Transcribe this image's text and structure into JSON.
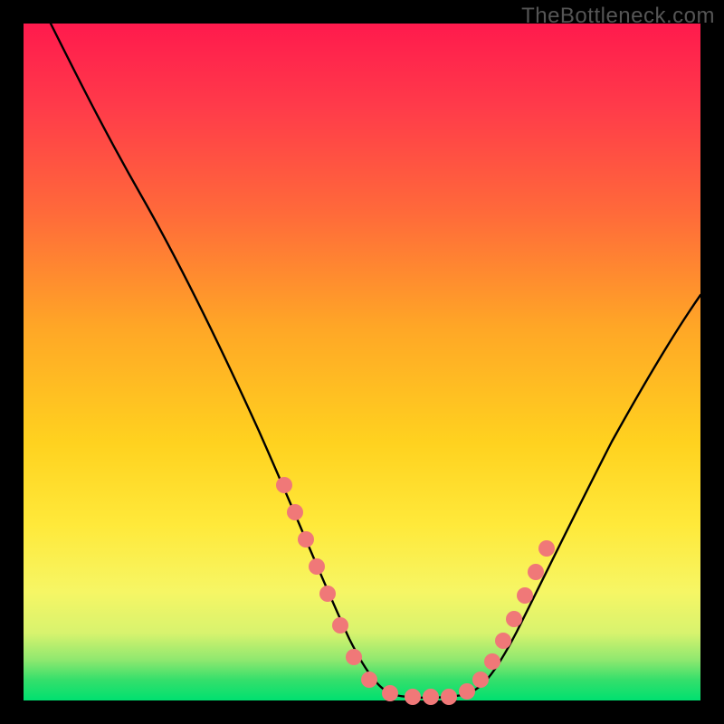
{
  "watermark": "TheBottleneck.com",
  "colors": {
    "frame": "#000000",
    "curve": "#000000",
    "dot": "#f07878",
    "gradient_top": "#ff1a4d",
    "gradient_mid": "#ffd21f",
    "gradient_bottom": "#00e070"
  },
  "chart_data": {
    "type": "line",
    "title": "",
    "xlabel": "",
    "ylabel": "",
    "xlim": [
      0,
      100
    ],
    "ylim": [
      0,
      100
    ],
    "grid": false,
    "legend": false,
    "note": "V-shaped bottleneck curve. y≈100 is deep red (high bottleneck), y≈0 is green (balanced). Curve drops from top-left to a flat trough around x 50–65, then rises toward upper right.",
    "series": [
      {
        "name": "bottleneck_curve",
        "x": [
          4,
          8,
          12,
          16,
          20,
          25,
          30,
          35,
          38,
          42,
          46,
          50,
          54,
          58,
          62,
          66,
          70,
          74,
          80,
          86,
          92,
          100
        ],
        "y": [
          100,
          94,
          87,
          79,
          71,
          61,
          50,
          38,
          30,
          20,
          10,
          3,
          1,
          1,
          1,
          2,
          6,
          13,
          24,
          36,
          48,
          60
        ]
      }
    ],
    "highlight_dots_left": {
      "x": [
        38,
        40,
        42,
        44,
        46,
        48,
        50,
        53,
        56,
        59
      ],
      "y": [
        30,
        25,
        20,
        15,
        10,
        6,
        3,
        1.5,
        1,
        1
      ]
    },
    "highlight_dots_right": {
      "x": [
        62,
        65,
        67,
        69,
        71,
        73,
        75,
        77
      ],
      "y": [
        1,
        2,
        4,
        7,
        10,
        14,
        18,
        22
      ]
    }
  }
}
